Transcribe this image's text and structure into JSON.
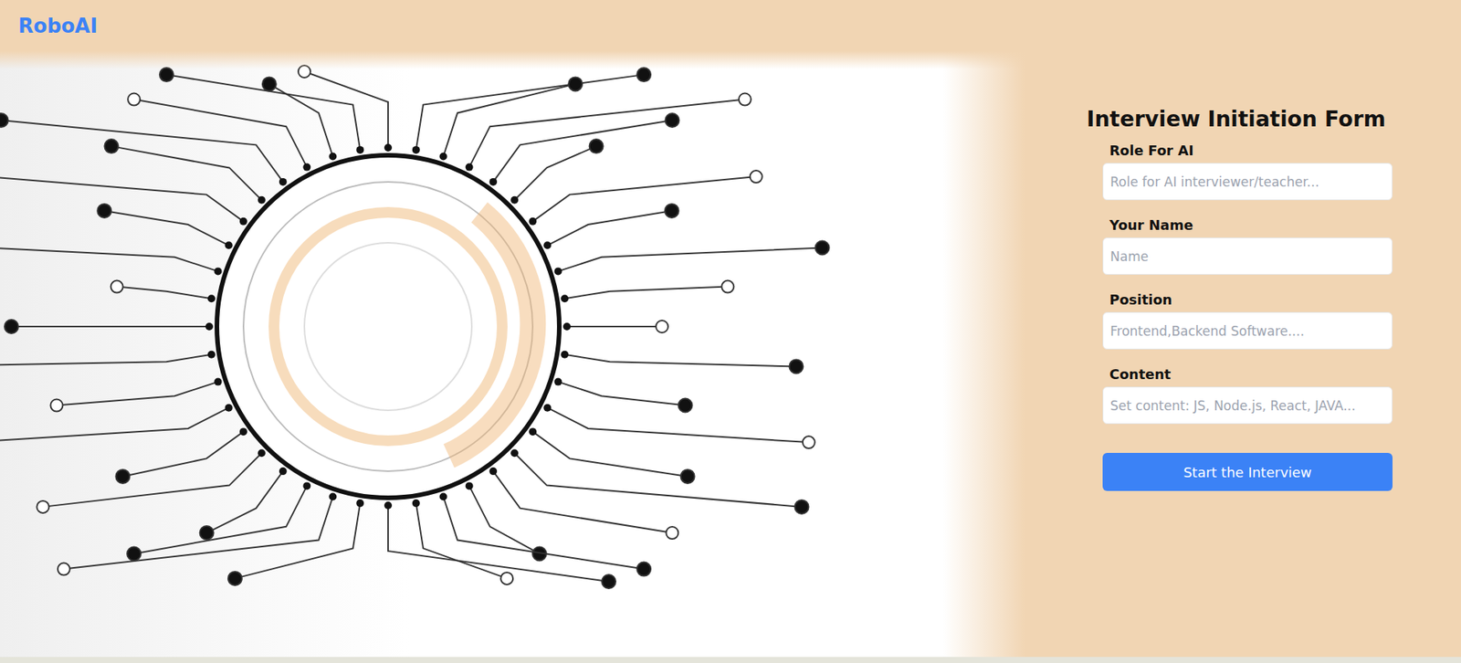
{
  "header": {
    "logo": "RoboAI"
  },
  "form": {
    "title": "Interview Initiation Form",
    "fields": [
      {
        "label": "Role For AI",
        "placeholder": "Role for AI interviewer/teacher..."
      },
      {
        "label": "Your Name",
        "placeholder": "Name"
      },
      {
        "label": "Position",
        "placeholder": "Frontend,Backend Software...."
      },
      {
        "label": "Content",
        "placeholder": "Set content: JS, Node.js, React, JAVA..."
      }
    ],
    "button": "Start the Interview"
  }
}
